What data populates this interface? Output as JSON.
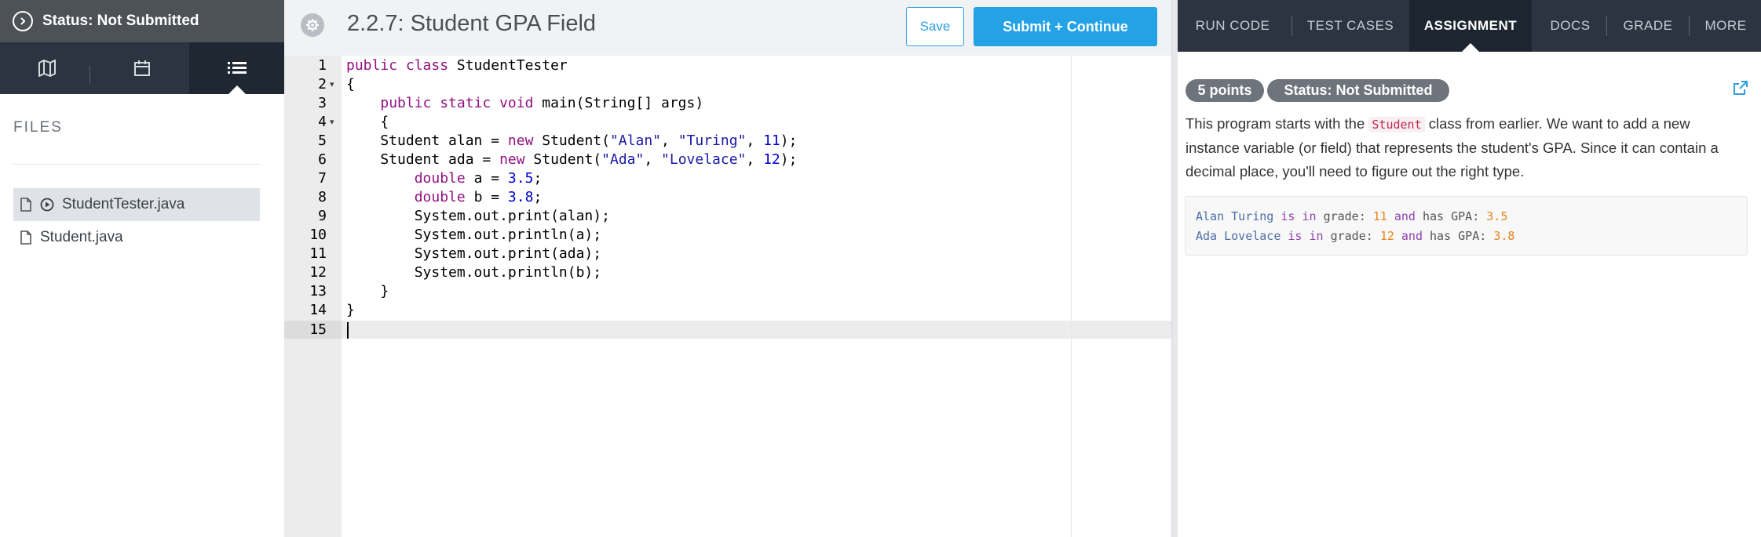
{
  "sidebar": {
    "status": "Status: Not Submitted",
    "nav_tabs": [
      "map-icon",
      "calendar-icon",
      "list-icon"
    ],
    "files_label": "FILES",
    "files": [
      {
        "name": "StudentTester.java",
        "active": true
      },
      {
        "name": "Student.java",
        "active": false
      }
    ]
  },
  "editor": {
    "title": "2.2.7: Student GPA Field",
    "save_label": "Save",
    "submit_label": "Submit + Continue",
    "line_numbers": [
      "1",
      "2",
      "3",
      "4",
      "5",
      "6",
      "7",
      "8",
      "9",
      "10",
      "11",
      "12",
      "13",
      "14",
      "15"
    ],
    "folds": {
      "2": "▾",
      "4": "▾"
    },
    "code": {
      "l1_a": "public class",
      "l1_b": " StudentTester",
      "l2": "{",
      "l3_a": "    ",
      "l3_b": "public static void",
      "l3_c": " main(String[] args)",
      "l4": "    {",
      "l5_a": "    Student alan = ",
      "l5_b": "new",
      "l5_c": " Student(",
      "l5_d": "\"Alan\"",
      "l5_e": ", ",
      "l5_f": "\"Turing\"",
      "l5_g": ", ",
      "l5_h": "11",
      "l5_i": ");",
      "l6_a": "    Student ada = ",
      "l6_b": "new",
      "l6_c": " Student(",
      "l6_d": "\"Ada\"",
      "l6_e": ", ",
      "l6_f": "\"Lovelace\"",
      "l6_g": ", ",
      "l6_h": "12",
      "l6_i": ");",
      "l7_a": "        ",
      "l7_b": "double",
      "l7_c": " a = ",
      "l7_d": "3.5",
      "l7_e": ";",
      "l8_a": "        ",
      "l8_b": "double",
      "l8_c": " b = ",
      "l8_d": "3.8",
      "l8_e": ";",
      "l9": "        System.out.print(alan);",
      "l10": "        System.out.println(a);",
      "l11": "        System.out.print(ada);",
      "l12": "        System.out.println(b);",
      "l13": "    }",
      "l14": "}",
      "l15": ""
    }
  },
  "right_panel": {
    "tabs": [
      {
        "label": "RUN CODE",
        "active": false
      },
      {
        "label": "TEST CASES",
        "active": false
      },
      {
        "label": "ASSIGNMENT",
        "active": true
      },
      {
        "label": "DOCS",
        "active": false
      },
      {
        "label": "GRADE",
        "active": false
      },
      {
        "label": "MORE",
        "active": false
      }
    ],
    "points_badge": "5 points",
    "status_badge": "Status: Not Submitted",
    "desc_part1": "This program starts with the ",
    "desc_code": "Student",
    "desc_part2": " class from earlier. We want to add a new instance variable (or field) that represents the student's GPA. Since it can contain a decimal place, you'll need to figure out the right type.",
    "sample": {
      "line1": {
        "name": "Alan Turing",
        "is": "is",
        "in": "in",
        "grade": "grade:",
        "num": "11",
        "and": "and",
        "has": "has GPA:",
        "gpa": "3.5"
      },
      "line2": {
        "name": "Ada Lovelace",
        "is": "is",
        "in": "in",
        "grade": "grade:",
        "num": "12",
        "and": "and",
        "has": "has GPA:",
        "gpa": "3.8"
      }
    }
  },
  "colors": {
    "nav_dark": "#2b3440",
    "accent_blue": "#23a3e6",
    "badge_gray": "#6e747b"
  }
}
